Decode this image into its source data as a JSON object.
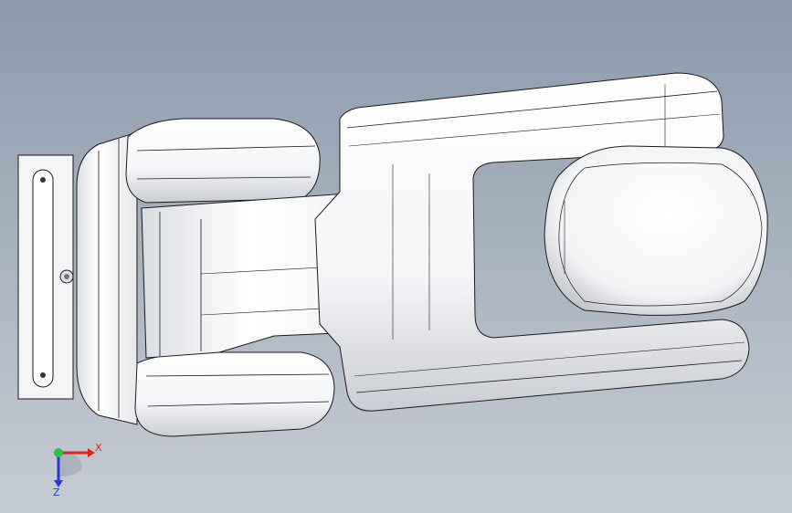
{
  "viewport": {
    "model": "robot-arm-assembly-top-view",
    "background_top": "#8c9aac",
    "background_bottom": "#c6ccd4",
    "part_fill": "#ffffff",
    "part_shade": "#e3e6ea",
    "edge_color": "#101010"
  },
  "triad": {
    "x_label": "X",
    "z_label": "Z",
    "x_color": "#e0201c",
    "y_color": "#2cc040",
    "z_color": "#2838d0"
  }
}
